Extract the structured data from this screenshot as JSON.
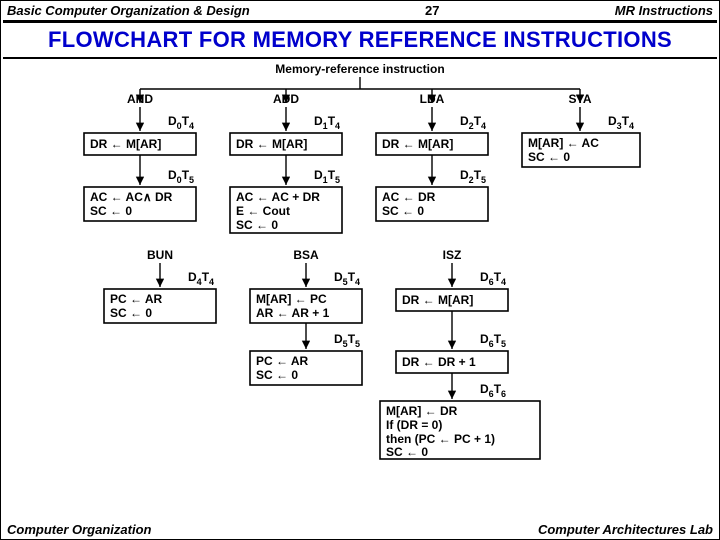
{
  "header": {
    "left": "Basic Computer Organization & Design",
    "page": "27",
    "right": "MR Instructions"
  },
  "title": "FLOWCHART FOR MEMORY REFERENCE INSTRUCTIONS",
  "start": "Memory-reference instruction",
  "top": {
    "c1": {
      "name": "AND",
      "t4": "D",
      "t4s": "0",
      "t4t": "T",
      "t4ts": "4",
      "b1": "DR ← M[AR]",
      "t5": "D",
      "t5s": "0",
      "t5t": "T",
      "t5ts": "5",
      "b2a": "AC ← AC∧ DR",
      "b2b": "SC ← 0"
    },
    "c2": {
      "name": "ADD",
      "t4": "D",
      "t4s": "1",
      "t4t": "T",
      "t4ts": "4",
      "b1": "DR ← M[AR]",
      "t5": "D",
      "t5s": "1",
      "t5t": "T",
      "t5ts": "5",
      "b2a": "AC ← AC + DR",
      "b2b": "E ← Cout",
      "b2c": "SC ← 0"
    },
    "c3": {
      "name": "LDA",
      "t4": "D",
      "t4s": "2",
      "t4t": "T",
      "t4ts": "4",
      "b1": "DR ← M[AR]",
      "t5": "D",
      "t5s": "2",
      "t5t": "T",
      "t5ts": "5",
      "b2a": "AC ← DR",
      "b2b": "SC ← 0"
    },
    "c4": {
      "name": "STA",
      "t4": "D",
      "t4s": "3",
      "t4t": "T",
      "t4ts": "4",
      "b1a": "M[AR] ← AC",
      "b1b": "SC ← 0"
    }
  },
  "bot": {
    "c1": {
      "name": "BUN",
      "t4": "D",
      "t4s": "4",
      "t4t": "T",
      "t4ts": "4",
      "b1a": "PC ← AR",
      "b1b": "SC ← 0"
    },
    "c2": {
      "name": "BSA",
      "t4": "D",
      "t4s": "5",
      "t4t": "T",
      "t4ts": "4",
      "b1a": "M[AR] ← PC",
      "b1b": "AR ← AR + 1",
      "t5": "D",
      "t5s": "5",
      "t5t": "T",
      "t5ts": "5",
      "b2a": "PC ← AR",
      "b2b": "SC ← 0"
    },
    "c3": {
      "name": "ISZ",
      "t4": "D",
      "t4s": "6",
      "t4t": "T",
      "t4ts": "4",
      "b1": "DR ← M[AR]",
      "t5": "D",
      "t5s": "6",
      "t5t": "T",
      "t5ts": "5",
      "b2": "DR ← DR + 1",
      "t6": "D",
      "t6s": "6",
      "t6t": "T",
      "t6ts": "6",
      "b3a": "M[AR] ← DR",
      "b3b": "If (DR = 0)",
      "b3c": "then (PC ← PC + 1)",
      "b3d": "SC ← 0"
    }
  },
  "footer": {
    "left": "Computer Organization",
    "right": "Computer Architectures Lab"
  }
}
